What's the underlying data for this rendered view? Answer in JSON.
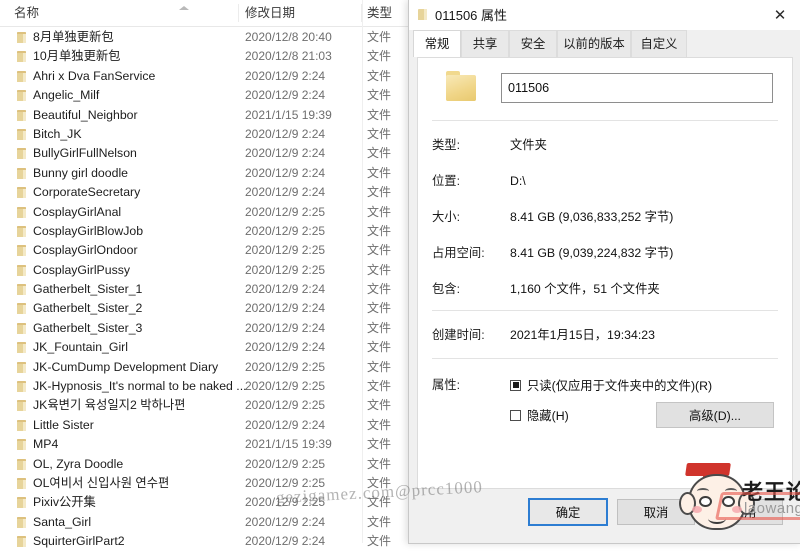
{
  "explorer": {
    "columns": [
      {
        "key": "name",
        "label": "名称"
      },
      {
        "key": "date",
        "label": "修改日期"
      },
      {
        "key": "type",
        "label": "类型"
      }
    ],
    "sort_indicator": "chevron-up-icon",
    "rows": [
      {
        "name": "8月单独更新包",
        "date": "2020/12/8 20:40",
        "type": "文件"
      },
      {
        "name": "10月单独更新包",
        "date": "2020/12/8 21:03",
        "type": "文件"
      },
      {
        "name": "Ahri x Dva FanService",
        "date": "2020/12/9 2:24",
        "type": "文件"
      },
      {
        "name": "Angelic_Milf",
        "date": "2020/12/9 2:24",
        "type": "文件"
      },
      {
        "name": "Beautiful_Neighbor",
        "date": "2021/1/15 19:39",
        "type": "文件"
      },
      {
        "name": "Bitch_JK",
        "date": "2020/12/9 2:24",
        "type": "文件"
      },
      {
        "name": "BullyGirlFullNelson",
        "date": "2020/12/9 2:24",
        "type": "文件"
      },
      {
        "name": "Bunny girl doodle",
        "date": "2020/12/9 2:24",
        "type": "文件"
      },
      {
        "name": "CorporateSecretary",
        "date": "2020/12/9 2:24",
        "type": "文件"
      },
      {
        "name": "CosplayGirlAnal",
        "date": "2020/12/9 2:25",
        "type": "文件"
      },
      {
        "name": "CosplayGirlBlowJob",
        "date": "2020/12/9 2:25",
        "type": "文件"
      },
      {
        "name": "CosplayGirlOndoor",
        "date": "2020/12/9 2:25",
        "type": "文件"
      },
      {
        "name": "CosplayGirlPussy",
        "date": "2020/12/9 2:25",
        "type": "文件"
      },
      {
        "name": "Gatherbelt_Sister_1",
        "date": "2020/12/9 2:24",
        "type": "文件"
      },
      {
        "name": "Gatherbelt_Sister_2",
        "date": "2020/12/9 2:24",
        "type": "文件"
      },
      {
        "name": "Gatherbelt_Sister_3",
        "date": "2020/12/9 2:24",
        "type": "文件"
      },
      {
        "name": "JK_Fountain_Girl",
        "date": "2020/12/9 2:24",
        "type": "文件"
      },
      {
        "name": "JK-CumDump Development Diary",
        "date": "2020/12/9 2:25",
        "type": "文件"
      },
      {
        "name": "JK-Hypnosis_It's normal to be naked ...",
        "date": "2020/12/9 2:25",
        "type": "文件"
      },
      {
        "name": "JK육변기 육성일지2 박하나편",
        "date": "2020/12/9 2:25",
        "type": "文件"
      },
      {
        "name": "Little Sister",
        "date": "2020/12/9 2:24",
        "type": "文件"
      },
      {
        "name": "MP4",
        "date": "2021/1/15 19:39",
        "type": "文件"
      },
      {
        "name": "OL, Zyra Doodle",
        "date": "2020/12/9 2:25",
        "type": "文件"
      },
      {
        "name": "OL여비서 신입사원 연수편",
        "date": "2020/12/9 2:25",
        "type": "文件"
      },
      {
        "name": "Pixiv公开集",
        "date": "2020/12/9 2:25",
        "type": "文件"
      },
      {
        "name": "Santa_Girl",
        "date": "2020/12/9 2:24",
        "type": "文件"
      },
      {
        "name": "SquirterGirlPart2",
        "date": "2020/12/9 2:24",
        "type": "文件"
      }
    ]
  },
  "dialog": {
    "title": "011506 属性",
    "title_icon": "folder-icon",
    "close_label": "✕",
    "tabs": [
      {
        "label": "常规",
        "active": true
      },
      {
        "label": "共享",
        "active": false
      },
      {
        "label": "安全",
        "active": false
      },
      {
        "label": "以前的版本",
        "active": false
      },
      {
        "label": "自定义",
        "active": false
      }
    ],
    "folder_name": "011506",
    "properties": [
      {
        "label": "类型:",
        "value": "文件夹"
      },
      {
        "label": "位置:",
        "value": "D:\\"
      },
      {
        "label": "大小:",
        "value": "8.41 GB (9,036,833,252 字节)"
      },
      {
        "label": "占用空间:",
        "value": "8.41 GB (9,039,224,832 字节)"
      },
      {
        "label": "包含:",
        "value": "1,160 个文件，51 个文件夹"
      }
    ],
    "created": {
      "label": "创建时间:",
      "value": "2021年1月15日，19:34:23"
    },
    "attributes": {
      "label": "属性:",
      "readonly": {
        "text": "只读(仅应用于文件夹中的文件)(R)",
        "state": "filled"
      },
      "hidden": {
        "text": "隐藏(H)",
        "state": "unchecked"
      },
      "advanced_button": "高级(D)..."
    },
    "buttons": [
      {
        "label": "确定",
        "primary": true
      },
      {
        "label": "取消",
        "primary": false
      },
      {
        "label": "应用",
        "primary": false
      }
    ]
  },
  "watermarks": {
    "diagonal": "gezigamez.com@prcc1000",
    "brand_cn": "老王论坛",
    "brand_en": "laowang.vip"
  }
}
